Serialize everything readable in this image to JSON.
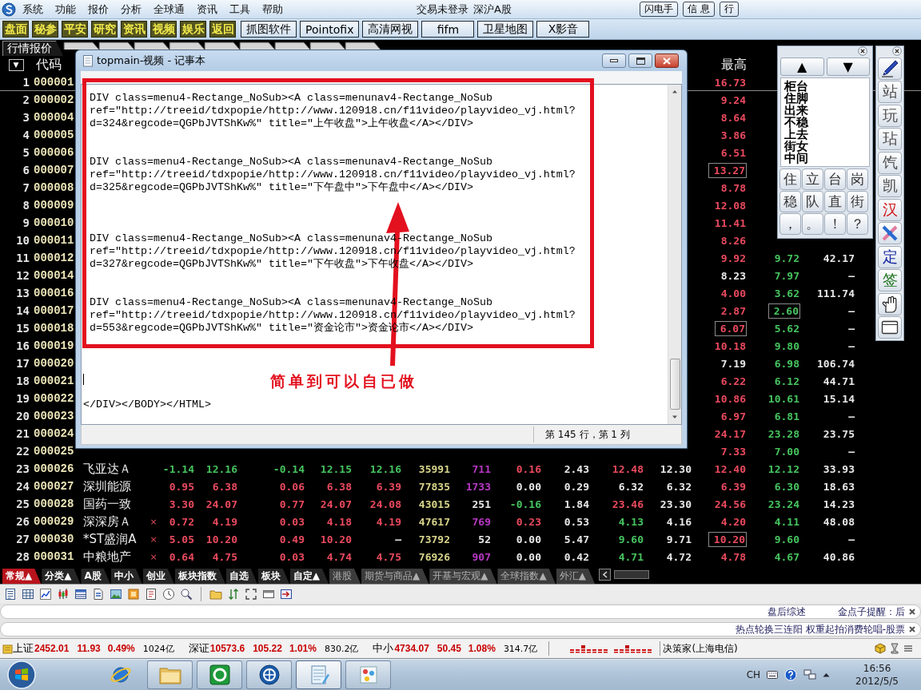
{
  "menu_bar": {
    "items": [
      "系统",
      "功能",
      "报价",
      "分析",
      "全球通",
      "资讯",
      "工具",
      "帮助"
    ],
    "login_status": "交易未登录",
    "market": "深沪A股",
    "buttons": [
      "闪电手",
      "信 息",
      "行"
    ]
  },
  "toolbar": {
    "buttons": [
      {
        "label": "盘面",
        "kind": "quick"
      },
      {
        "label": "秘参",
        "kind": "quick"
      },
      {
        "label": "平安",
        "kind": "quick"
      },
      {
        "label": "研究",
        "kind": "quick"
      },
      {
        "label": "资讯",
        "kind": "quick"
      },
      {
        "label": "视频",
        "kind": "quick"
      },
      {
        "label": "娱乐",
        "kind": "quick"
      },
      {
        "label": "返回",
        "kind": "quick"
      },
      {
        "label": "抓图软件",
        "kind": "app"
      },
      {
        "label": "Pointofix",
        "kind": "app"
      },
      {
        "label": "高清网视",
        "kind": "app"
      },
      {
        "label": "fifm",
        "kind": "app"
      },
      {
        "label": "卫星地图",
        "kind": "app"
      },
      {
        "label": "X影音",
        "kind": "app"
      }
    ]
  },
  "view_tabs": [
    {
      "label": "行情报价",
      "selected": true
    }
  ],
  "quote_table": {
    "sort_button": "▼",
    "headers": {
      "code": "代码",
      "column_12": "最高"
    },
    "rows": [
      {
        "index": "1",
        "code": "000001",
        "selected": true,
        "cells": {
          "column_12": {
            "text": "16.73",
            "kind": "up"
          }
        }
      },
      {
        "index": "2",
        "code": "000002",
        "selected": false,
        "cells": {
          "column_12": {
            "text": "9.24",
            "kind": "up"
          }
        }
      },
      {
        "index": "3",
        "code": "000004",
        "selected": false,
        "cells": {
          "column_12": {
            "text": "8.64",
            "kind": "up"
          }
        }
      },
      {
        "index": "4",
        "code": "000005",
        "selected": false,
        "cells": {
          "column_12": {
            "text": "3.86",
            "kind": "up"
          }
        }
      },
      {
        "index": "5",
        "code": "000006",
        "selected": false,
        "cells": {
          "column_12": {
            "text": "6.51",
            "kind": "up"
          }
        }
      },
      {
        "index": "6",
        "code": "000007",
        "selected": false,
        "cells": {
          "column_12": {
            "text": "13.27",
            "kind": "up",
            "boxed": true
          }
        }
      },
      {
        "index": "7",
        "code": "000008",
        "selected": false,
        "cells": {
          "column_12": {
            "text": "8.78",
            "kind": "up"
          }
        }
      },
      {
        "index": "8",
        "code": "000009",
        "selected": false,
        "cells": {
          "column_12": {
            "text": "12.08",
            "kind": "up"
          }
        }
      },
      {
        "index": "9",
        "code": "000010",
        "selected": false,
        "cells": {
          "column_12": {
            "text": "11.41",
            "kind": "up"
          }
        }
      },
      {
        "index": "10",
        "code": "000011",
        "selected": false,
        "cells": {
          "column_12": {
            "text": "8.26",
            "kind": "up"
          }
        }
      },
      {
        "index": "11",
        "code": "000012",
        "selected": false,
        "cells": {
          "column_12": {
            "text": "9.92",
            "kind": "up"
          },
          "column_13": {
            "text": "9.72",
            "kind": "down"
          },
          "column_14": {
            "text": "42.17",
            "kind": "flat"
          }
        }
      },
      {
        "index": "12",
        "code": "000014",
        "selected": false,
        "cells": {
          "column_12": {
            "text": "8.23",
            "kind": "flat"
          },
          "column_13": {
            "text": "7.97",
            "kind": "down"
          },
          "column_14": {
            "text": "—",
            "kind": "flat"
          }
        }
      },
      {
        "index": "13",
        "code": "000016",
        "selected": false,
        "cells": {
          "column_12": {
            "text": "4.00",
            "kind": "up"
          },
          "column_13": {
            "text": "3.62",
            "kind": "down"
          },
          "column_14": {
            "text": "111.74",
            "kind": "flat"
          }
        }
      },
      {
        "index": "14",
        "code": "000017",
        "selected": false,
        "cells": {
          "column_12": {
            "text": "2.87",
            "kind": "up"
          },
          "column_13": {
            "text": "2.60",
            "kind": "down",
            "boxed": true
          },
          "column_14": {
            "text": "—",
            "kind": "flat"
          }
        }
      },
      {
        "index": "15",
        "code": "000018",
        "selected": false,
        "cells": {
          "column_12": {
            "text": "6.07",
            "kind": "up",
            "boxed": true
          },
          "column_13": {
            "text": "5.62",
            "kind": "down"
          },
          "column_14": {
            "text": "—",
            "kind": "flat"
          }
        }
      },
      {
        "index": "16",
        "code": "000019",
        "selected": false,
        "cells": {
          "column_12": {
            "text": "10.18",
            "kind": "up"
          },
          "column_13": {
            "text": "9.80",
            "kind": "down"
          },
          "column_14": {
            "text": "—",
            "kind": "flat"
          }
        }
      },
      {
        "index": "17",
        "code": "000020",
        "selected": false,
        "cells": {
          "column_12": {
            "text": "7.19",
            "kind": "flat"
          },
          "column_13": {
            "text": "6.98",
            "kind": "down"
          },
          "column_14": {
            "text": "106.74",
            "kind": "flat"
          }
        }
      },
      {
        "index": "18",
        "code": "000021",
        "selected": false,
        "cells": {
          "column_12": {
            "text": "6.22",
            "kind": "up"
          },
          "column_13": {
            "text": "6.12",
            "kind": "down"
          },
          "column_14": {
            "text": "44.71",
            "kind": "flat"
          }
        }
      },
      {
        "index": "19",
        "code": "000022",
        "selected": false,
        "cells": {
          "column_12": {
            "text": "10.86",
            "kind": "up"
          },
          "column_13": {
            "text": "10.61",
            "kind": "down"
          },
          "column_14": {
            "text": "15.14",
            "kind": "flat"
          }
        }
      },
      {
        "index": "20",
        "code": "000023",
        "selected": false,
        "cells": {
          "column_12": {
            "text": "6.97",
            "kind": "up"
          },
          "column_13": {
            "text": "6.81",
            "kind": "down"
          },
          "column_14": {
            "text": "—",
            "kind": "flat"
          }
        }
      },
      {
        "index": "21",
        "code": "000024",
        "selected": false,
        "cells": {
          "column_12": {
            "text": "24.17",
            "kind": "up"
          },
          "column_13": {
            "text": "23.28",
            "kind": "down"
          },
          "column_14": {
            "text": "23.75",
            "kind": "flat"
          }
        }
      },
      {
        "index": "22",
        "code": "000025",
        "selected": false,
        "cells": {
          "column_12": {
            "text": "7.33",
            "kind": "up"
          },
          "column_13": {
            "text": "7.00",
            "kind": "down"
          },
          "column_14": {
            "text": "—",
            "kind": "flat"
          }
        }
      },
      {
        "index": "23",
        "code": "000026",
        "name": "飞亚达Ａ",
        "selected": false,
        "cells": {
          "column_1": {
            "text": "-1.14",
            "kind": "down"
          },
          "column_2": {
            "text": "12.16",
            "kind": "down"
          },
          "column_3": {
            "text": "-0.14",
            "kind": "down"
          },
          "column_4": {
            "text": "12.15",
            "kind": "down"
          },
          "column_5": {
            "text": "12.16",
            "kind": "down"
          },
          "column_6": {
            "text": "35991",
            "kind": "volume"
          },
          "column_7": {
            "text": "711",
            "kind": "violet"
          },
          "column_8": {
            "text": "0.16",
            "kind": "up"
          },
          "column_9": {
            "text": "2.43",
            "kind": "flat"
          },
          "column_10": {
            "text": "12.48",
            "kind": "up"
          },
          "column_11": {
            "text": "12.30",
            "kind": "flat"
          },
          "column_12": {
            "text": "12.40",
            "kind": "up"
          },
          "column_13": {
            "text": "12.12",
            "kind": "down"
          },
          "column_14": {
            "text": "33.93",
            "kind": "flat"
          }
        }
      },
      {
        "index": "24",
        "code": "000027",
        "name": "深圳能源",
        "selected": false,
        "cells": {
          "column_1": {
            "text": "0.95",
            "kind": "up"
          },
          "column_2": {
            "text": "6.38",
            "kind": "up"
          },
          "column_3": {
            "text": "0.06",
            "kind": "up"
          },
          "column_4": {
            "text": "6.38",
            "kind": "up"
          },
          "column_5": {
            "text": "6.39",
            "kind": "up"
          },
          "column_6": {
            "text": "77835",
            "kind": "volume"
          },
          "column_7": {
            "text": "1733",
            "kind": "violet"
          },
          "column_8": {
            "text": "0.00",
            "kind": "flat"
          },
          "column_9": {
            "text": "0.29",
            "kind": "flat"
          },
          "column_10": {
            "text": "6.32",
            "kind": "flat"
          },
          "column_11": {
            "text": "6.32",
            "kind": "flat"
          },
          "column_12": {
            "text": "6.39",
            "kind": "up"
          },
          "column_13": {
            "text": "6.30",
            "kind": "down"
          },
          "column_14": {
            "text": "18.63",
            "kind": "flat"
          }
        }
      },
      {
        "index": "25",
        "code": "000028",
        "name": "国药一致",
        "selected": false,
        "cells": {
          "column_1": {
            "text": "3.30",
            "kind": "up"
          },
          "column_2": {
            "text": "24.07",
            "kind": "up"
          },
          "column_3": {
            "text": "0.77",
            "kind": "up"
          },
          "column_4": {
            "text": "24.07",
            "kind": "up"
          },
          "column_5": {
            "text": "24.08",
            "kind": "up"
          },
          "column_6": {
            "text": "43015",
            "kind": "volume"
          },
          "column_7": {
            "text": "251",
            "kind": "flat"
          },
          "column_8": {
            "text": "-0.16",
            "kind": "down"
          },
          "column_9": {
            "text": "1.84",
            "kind": "flat"
          },
          "column_10": {
            "text": "23.46",
            "kind": "up"
          },
          "column_11": {
            "text": "23.30",
            "kind": "flat"
          },
          "column_12": {
            "text": "24.56",
            "kind": "up"
          },
          "column_13": {
            "text": "23.24",
            "kind": "down"
          },
          "column_14": {
            "text": "14.23",
            "kind": "flat"
          }
        }
      },
      {
        "index": "26",
        "code": "000029",
        "name": "深深房Ａ",
        "flag": "×",
        "selected": false,
        "cells": {
          "column_1": {
            "text": "0.72",
            "kind": "up"
          },
          "column_2": {
            "text": "4.19",
            "kind": "up"
          },
          "column_3": {
            "text": "0.03",
            "kind": "up"
          },
          "column_4": {
            "text": "4.18",
            "kind": "up"
          },
          "column_5": {
            "text": "4.19",
            "kind": "up"
          },
          "column_6": {
            "text": "47617",
            "kind": "volume"
          },
          "column_7": {
            "text": "769",
            "kind": "violet"
          },
          "column_8": {
            "text": "0.23",
            "kind": "up"
          },
          "column_9": {
            "text": "0.53",
            "kind": "flat"
          },
          "column_10": {
            "text": "4.13",
            "kind": "down"
          },
          "column_11": {
            "text": "4.16",
            "kind": "flat"
          },
          "column_12": {
            "text": "4.20",
            "kind": "up"
          },
          "column_13": {
            "text": "4.11",
            "kind": "down"
          },
          "column_14": {
            "text": "48.08",
            "kind": "flat"
          }
        }
      },
      {
        "index": "27",
        "code": "000030",
        "name": "*ST盛润A",
        "flag": "×",
        "selected": false,
        "cells": {
          "column_1": {
            "text": "5.05",
            "kind": "up"
          },
          "column_2": {
            "text": "10.20",
            "kind": "up"
          },
          "column_3": {
            "text": "0.49",
            "kind": "up"
          },
          "column_4": {
            "text": "10.20",
            "kind": "up"
          },
          "column_5": {
            "text": "—",
            "kind": "flat"
          },
          "column_6": {
            "text": "73792",
            "kind": "volume"
          },
          "column_7": {
            "text": "52",
            "kind": "flat"
          },
          "column_8": {
            "text": "0.00",
            "kind": "flat"
          },
          "column_9": {
            "text": "5.47",
            "kind": "flat"
          },
          "column_10": {
            "text": "9.60",
            "kind": "down"
          },
          "column_11": {
            "text": "9.71",
            "kind": "flat"
          },
          "column_12": {
            "text": "10.20",
            "kind": "up",
            "boxed": true
          },
          "column_13": {
            "text": "9.60",
            "kind": "down"
          },
          "column_14": {
            "text": "—",
            "kind": "flat"
          }
        }
      },
      {
        "index": "28",
        "code": "000031",
        "name": "中粮地产",
        "flag": "×",
        "selected": false,
        "cells": {
          "column_1": {
            "text": "0.64",
            "kind": "up"
          },
          "column_2": {
            "text": "4.75",
            "kind": "up"
          },
          "column_3": {
            "text": "0.03",
            "kind": "up"
          },
          "column_4": {
            "text": "4.74",
            "kind": "up"
          },
          "column_5": {
            "text": "4.75",
            "kind": "up"
          },
          "column_6": {
            "text": "76926",
            "kind": "volume"
          },
          "column_7": {
            "text": "907",
            "kind": "violet"
          },
          "column_8": {
            "text": "0.00",
            "kind": "flat"
          },
          "column_9": {
            "text": "0.42",
            "kind": "flat"
          },
          "column_10": {
            "text": "4.71",
            "kind": "down"
          },
          "column_11": {
            "text": "4.72",
            "kind": "flat"
          },
          "column_12": {
            "text": "4.78",
            "kind": "up"
          },
          "column_13": {
            "text": "4.67",
            "kind": "down"
          },
          "column_14": {
            "text": "40.86",
            "kind": "flat"
          }
        }
      }
    ]
  },
  "notepad": {
    "title": "topmain-视频 - 记事本",
    "content": [
      {
        "kind": "text",
        "lines": [
          "DIV class=menu4-Rectange_NoSub><A class=menunav4-Rectange_NoSub",
          "ref=\"http://treeid/tdxpopie/http://www.120918.cn/f11video/playvideo_vj.html?",
          "d=324&regcode=QGPbJVTShKw%\" title=\"上午收盘\">上午收盘</A></DIV>"
        ]
      },
      {
        "kind": "text",
        "lines": [
          "DIV class=menu4-Rectange_NoSub><A class=menunav4-Rectange_NoSub",
          "ref=\"http://treeid/tdxpopie/http://www.120918.cn/f11video/playvideo_vj.html?",
          "d=325&regcode=QGPbJVTShKw%\" title=\"下午盘中\">下午盘中</A></DIV>"
        ]
      },
      {
        "kind": "text",
        "lines": [
          "DIV class=menu4-Rectange_NoSub><A class=menunav4-Rectange_NoSub",
          "ref=\"http://treeid/tdxpopie/http://www.120918.cn/f11video/playvideo_vj.html?",
          "d=327&regcode=QGPbJVTShKw%\" title=\"下午收盘\">下午收盘</A></DIV>"
        ]
      },
      {
        "kind": "text",
        "lines": [
          "DIV class=menu4-Rectange_NoSub><A class=menunav4-Rectange_NoSub",
          "ref=\"http://treeid/tdxpopie/http://www.120918.cn/f11video/playvideo_vj.html?",
          "d=553&regcode=QGPbJVTShKw%\" title=\"资金论市\">资金论市</A></DIV>"
        ]
      },
      {
        "kind": "caret"
      },
      {
        "kind": "text",
        "lines": [
          "</DIV></BODY></HTML>"
        ]
      }
    ],
    "status": "第 145 行，第 1 列"
  },
  "annotation": "简单到可以自已做",
  "input_panel": {
    "page_buttons": [
      "▲",
      "▼"
    ],
    "candidates": [
      "柜台",
      "住脚",
      "出来",
      "不稳",
      "上去",
      "街女",
      "中间"
    ],
    "keys": [
      "住",
      "立",
      "台",
      "岗",
      "稳",
      "队",
      "直",
      "街",
      "，",
      "。",
      "！",
      "？"
    ]
  },
  "tool_strip": [
    {
      "kind": "tool"
    },
    {
      "kind": "glyph",
      "text": "站",
      "color": "#505050"
    },
    {
      "kind": "glyph",
      "text": "玩",
      "color": "#505050"
    },
    {
      "kind": "glyph",
      "text": "玷",
      "color": "#505050"
    },
    {
      "kind": "glyph",
      "text": "饩",
      "color": "#505050"
    },
    {
      "kind": "glyph",
      "text": "凯",
      "color": "#505050"
    },
    {
      "kind": "glyph",
      "text": "汉",
      "color": "#d01818"
    },
    {
      "kind": "tool"
    },
    {
      "kind": "glyph",
      "text": "定",
      "color": "#1828a0"
    },
    {
      "kind": "glyph",
      "text": "签",
      "color": "#187018"
    },
    {
      "kind": "tool"
    },
    {
      "kind": "tool"
    }
  ],
  "market_tabs": [
    {
      "label": "常规▲",
      "selected": true,
      "kind": "local"
    },
    {
      "label": "分类▲",
      "selected": false,
      "kind": "local"
    },
    {
      "label": "A股",
      "selected": false,
      "kind": "local"
    },
    {
      "label": "中小",
      "selected": false,
      "kind": "local"
    },
    {
      "label": "创业",
      "selected": false,
      "kind": "local"
    },
    {
      "label": "板块指数",
      "selected": false,
      "kind": "local"
    },
    {
      "label": "自选",
      "selected": false,
      "kind": "local"
    },
    {
      "label": "板块",
      "selected": false,
      "kind": "local"
    },
    {
      "label": "自定▲",
      "selected": false,
      "kind": "local"
    },
    {
      "label": "港股",
      "selected": false,
      "kind": "global"
    },
    {
      "label": "期货与商品▲",
      "selected": false,
      "kind": "global"
    },
    {
      "label": "开基与宏观▲",
      "selected": false,
      "kind": "global"
    },
    {
      "label": "全球指数▲",
      "selected": false,
      "kind": "global"
    },
    {
      "label": "外汇▲",
      "selected": false,
      "kind": "global"
    }
  ],
  "tickers": [
    {
      "items": [
        "盘后综述",
        "金点子提醒：后"
      ]
    },
    {
      "items": [
        "热点轮换三连阳 权重起拍消费轮唱-股票"
      ]
    }
  ],
  "index_bar": {
    "indices": [
      {
        "name": "上证",
        "value": "2452.01",
        "change": "11.93",
        "percent": "0.49%",
        "amount": "1024亿",
        "kind": "up"
      },
      {
        "name": "深证",
        "value": "10573.6",
        "change": "105.22",
        "percent": "1.01%",
        "amount": "830.2亿",
        "kind": "up"
      },
      {
        "name": "中小",
        "value": "4734.07",
        "change": "50.45",
        "percent": "1.08%",
        "amount": "314.7亿",
        "kind": "up"
      }
    ],
    "source": "决策家(上海电信)"
  },
  "taskbar": {
    "apps": [
      {
        "running": false,
        "selected": false
      },
      {
        "running": true,
        "selected": false
      },
      {
        "running": true,
        "selected": false
      },
      {
        "running": true,
        "selected": false
      },
      {
        "running": true,
        "selected": true
      },
      {
        "running": true,
        "selected": false
      }
    ],
    "language": "CH",
    "time": "16:56",
    "date": "2012/5/5"
  }
}
